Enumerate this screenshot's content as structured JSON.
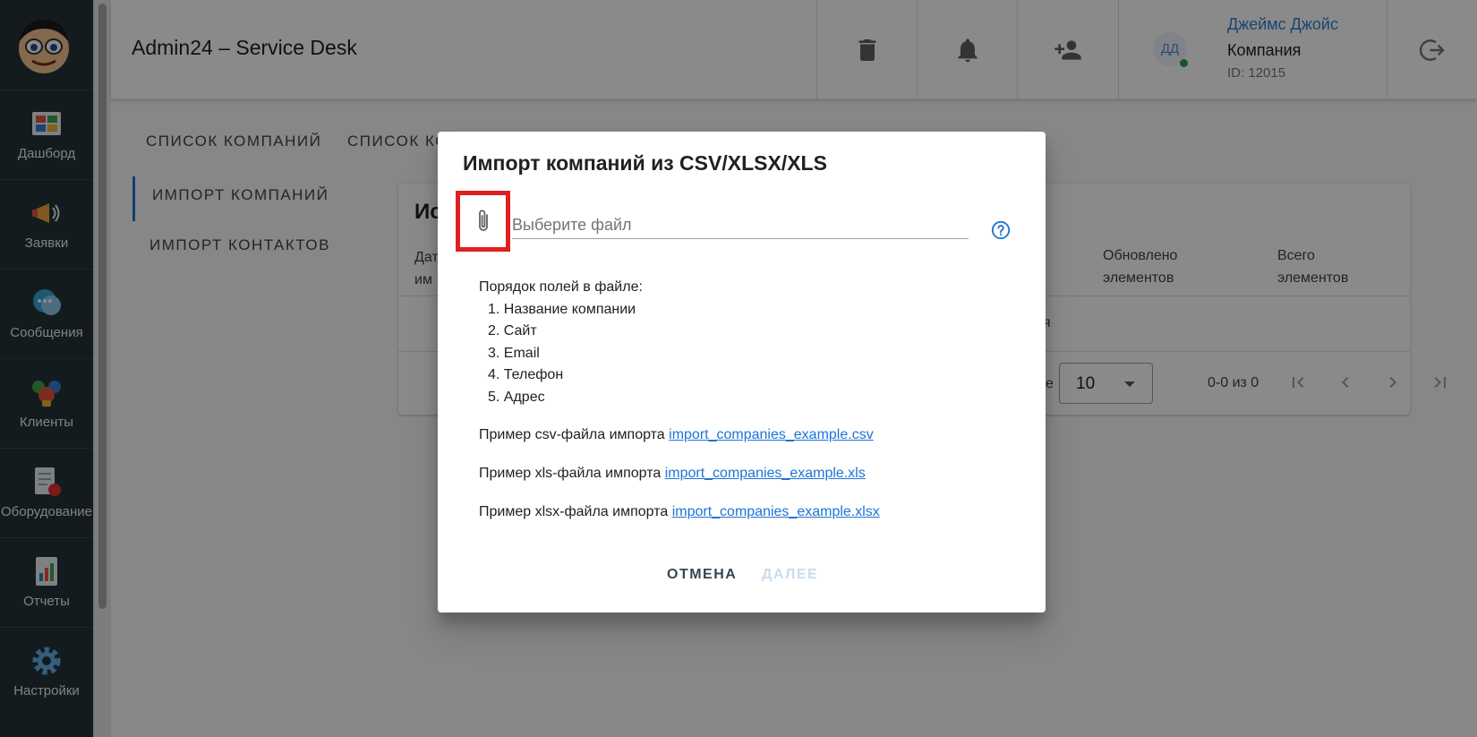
{
  "header": {
    "title": "Admin24 – Service Desk",
    "icons": [
      "trash-icon",
      "bell-icon",
      "add-person-icon",
      "logout-icon"
    ],
    "avatar_initials": "ДД",
    "user_name": "Джеймс Джойс",
    "company": "Компания",
    "user_id": "ID: 12015"
  },
  "sidebar": {
    "items": [
      {
        "label": "Дашборд",
        "icon": "dashboard-icon"
      },
      {
        "label": "Заявки",
        "icon": "megaphone-icon"
      },
      {
        "label": "Сообщения",
        "icon": "chat-icon"
      },
      {
        "label": "Клиенты",
        "icon": "clients-icon"
      },
      {
        "label": "Оборудование",
        "icon": "equipment-icon"
      },
      {
        "label": "Отчеты",
        "icon": "reports-icon"
      },
      {
        "label": "Настройки",
        "icon": "settings-icon"
      }
    ]
  },
  "tabs": {
    "companies_list": "СПИСОК КОМПАНИЙ",
    "contacts_list": "СПИСОК КС"
  },
  "side_tabs": {
    "import_companies": "ИМПОРТ КОМПАНИЙ",
    "import_contacts": "ИМПОРТ КОНТАКТОВ"
  },
  "card": {
    "title_fragment": "Ис",
    "col_date_1": "Дат",
    "col_date_2": "им",
    "col_updated_1": "Обновлено",
    "col_updated_2": "элементов",
    "col_total_1": "Всего",
    "col_total_2": "элементов",
    "empty_fragment": "я",
    "rows_label_fragment": "е",
    "rows_per_page": "10",
    "range": "0-0 из 0"
  },
  "dialog": {
    "title": "Импорт компаний из CSV/XLSX/XLS",
    "file_placeholder": "Выберите файл",
    "fields_heading": "Порядок полей в файле:",
    "fields": [
      "1. Название компании",
      "2. Сайт",
      "3. Email",
      "4. Телефон",
      "5. Адрес"
    ],
    "csv_text": "Пример csv-файла импорта",
    "csv_link": "import_companies_example.csv",
    "xls_text": "Пример xls-файла импорта",
    "xls_link": "import_companies_example.xls",
    "xlsx_text": "Пример xlsx-файла импорта",
    "xlsx_link": "import_companies_example.xlsx",
    "cancel_label": "ОТМЕНА",
    "next_label": "ДАЛЕЕ"
  },
  "colors": {
    "sidebar_bg": "#263238",
    "accent": "#1976d2",
    "link": "#1e74d6",
    "highlight_box": "#e02020",
    "online": "#2e9e4a"
  }
}
